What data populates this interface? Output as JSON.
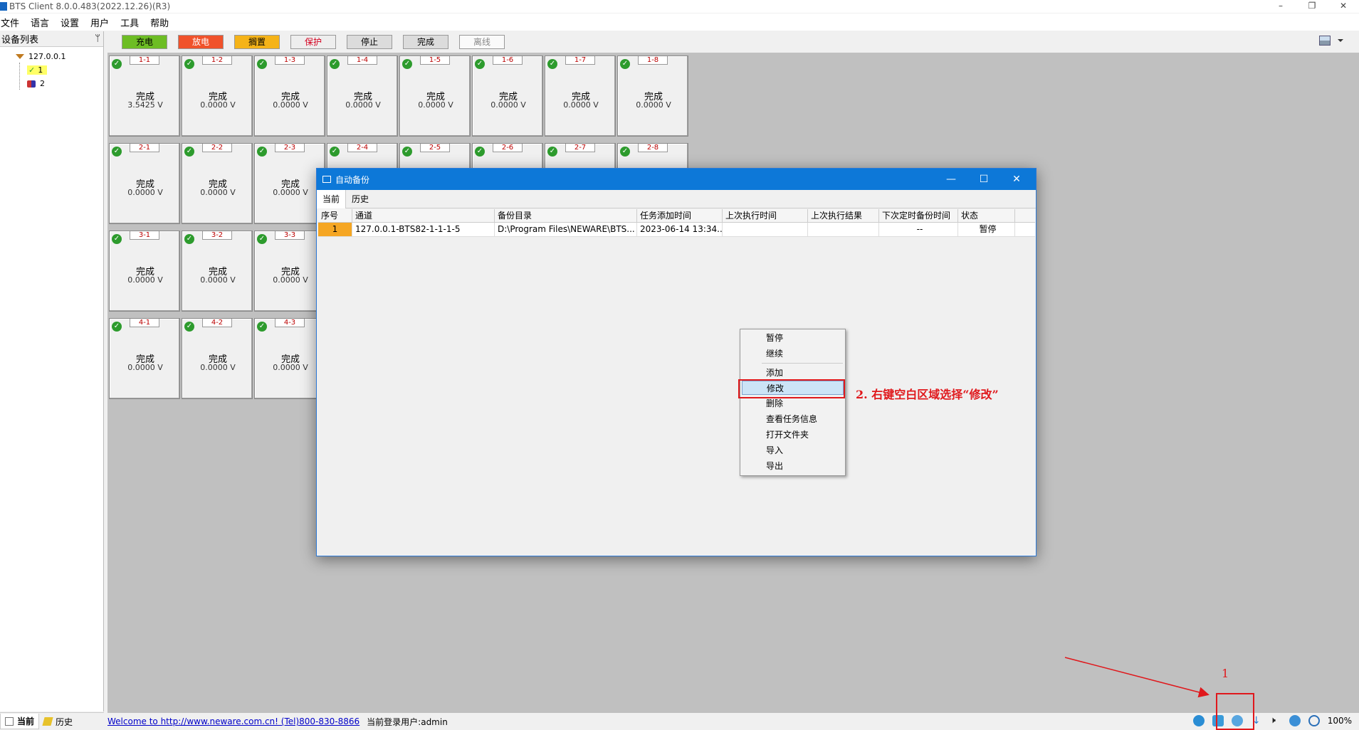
{
  "window": {
    "title": "BTS Client 8.0.0.483(2022.12.26)(R3)",
    "minimize": "–",
    "restore": "❐",
    "close": "✕"
  },
  "menu": [
    "文件",
    "语言",
    "设置",
    "用户",
    "工具",
    "帮助"
  ],
  "left_panel": {
    "title": "设备列表",
    "pin": "ᛘ",
    "tree": {
      "root": "127.0.0.1",
      "child1": "1",
      "child2": "2"
    },
    "bottom_tabs": [
      "当前",
      "历史"
    ]
  },
  "legend": [
    {
      "label": "充电",
      "bg": "#6dbd24",
      "color": "#000000"
    },
    {
      "label": "放电",
      "bg": "#f0522b",
      "color": "#ffffff"
    },
    {
      "label": "搁置",
      "bg": "#f5b318",
      "color": "#000000"
    },
    {
      "label": "保护",
      "bg": "#eeeeee",
      "color": "#d4001f"
    },
    {
      "label": "停止",
      "bg": "#dcdcdc",
      "color": "#000000"
    },
    {
      "label": "完成",
      "bg": "#dcdcdc",
      "color": "#000000"
    },
    {
      "label": "离线",
      "bg": "#fafafa",
      "color": "#888888"
    }
  ],
  "channels": [
    {
      "id": "1-1",
      "status": "完成",
      "volt": "3.5425 V"
    },
    {
      "id": "1-2",
      "status": "完成",
      "volt": "0.0000 V"
    },
    {
      "id": "1-3",
      "status": "完成",
      "volt": "0.0000 V"
    },
    {
      "id": "1-4",
      "status": "完成",
      "volt": "0.0000 V"
    },
    {
      "id": "1-5",
      "status": "完成",
      "volt": "0.0000 V"
    },
    {
      "id": "1-6",
      "status": "完成",
      "volt": "0.0000 V"
    },
    {
      "id": "1-7",
      "status": "完成",
      "volt": "0.0000 V"
    },
    {
      "id": "1-8",
      "status": "完成",
      "volt": "0.0000 V"
    },
    {
      "id": "2-1",
      "status": "完成",
      "volt": "0.0000 V"
    },
    {
      "id": "2-2",
      "status": "完成",
      "volt": "0.0000 V"
    },
    {
      "id": "2-3",
      "status": "完成",
      "volt": "0.0000 V"
    },
    {
      "id": "2-4",
      "status": "",
      "volt": ""
    },
    {
      "id": "2-5",
      "status": "",
      "volt": ""
    },
    {
      "id": "2-6",
      "status": "",
      "volt": ""
    },
    {
      "id": "2-7",
      "status": "",
      "volt": ""
    },
    {
      "id": "2-8",
      "status": "",
      "volt": ""
    },
    {
      "id": "3-1",
      "status": "完成",
      "volt": "0.0000 V"
    },
    {
      "id": "3-2",
      "status": "完成",
      "volt": "0.0000 V"
    },
    {
      "id": "3-3",
      "status": "完成",
      "volt": "0.0000 V"
    },
    {
      "id": "4-1",
      "status": "完成",
      "volt": "0.0000 V"
    },
    {
      "id": "4-2",
      "status": "完成",
      "volt": "0.0000 V"
    },
    {
      "id": "4-3",
      "status": "完成",
      "volt": "0.0000 V"
    }
  ],
  "status_bar": {
    "welcome": "Welcome to http://www.neware.com.cn! (Tel)800-830-8866",
    "user": "当前登录用户:admin",
    "zoom": "100%"
  },
  "dialog": {
    "title": "自动备份",
    "minimize": "—",
    "maximize": "☐",
    "close": "✕",
    "tabs": [
      "当前",
      "历史"
    ],
    "columns": [
      "序号",
      "通道",
      "备份目录",
      "任务添加时间",
      "上次执行时间",
      "上次执行结果",
      "下次定时备份时间",
      "状态"
    ],
    "rows": [
      [
        "1",
        "127.0.0.1-BTS82-1-1-1-5",
        "D:\\Program Files\\NEWARE\\BTS...",
        "2023-06-14 13:34...",
        "",
        "",
        "--",
        "暂停"
      ]
    ]
  },
  "context_menu": [
    "暂停",
    "继续",
    "添加",
    "修改",
    "删除",
    "查看任务信息",
    "打开文件夹",
    "导入",
    "导出"
  ],
  "annotations": {
    "step2": "2. 右键空白区域选择“修改”",
    "step1": "1"
  }
}
